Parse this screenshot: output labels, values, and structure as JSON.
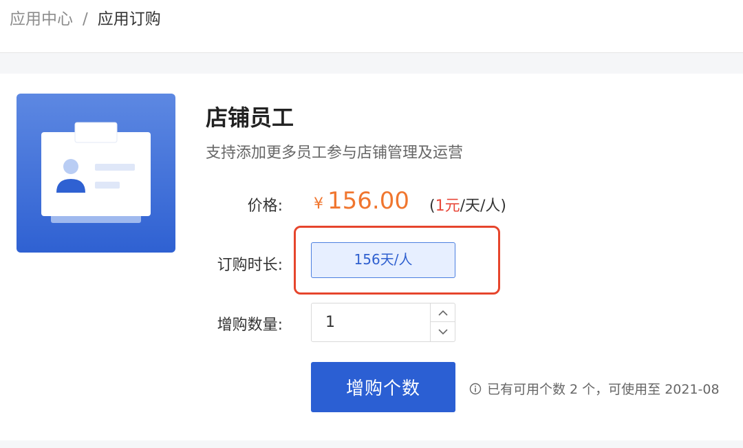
{
  "breadcrumb": {
    "parent": "应用中心",
    "separator": "/",
    "current": "应用订购"
  },
  "product": {
    "title": "店铺员工",
    "description": "支持添加更多员工参与店铺管理及运营",
    "icon": "staff-badge-icon"
  },
  "price": {
    "label": "价格:",
    "currency": "¥",
    "amount": "156.00",
    "unit_open": "(",
    "unit_price": "1元",
    "unit_rest": "/天/人)"
  },
  "duration": {
    "label": "订购时长:",
    "selected_option": "156天/人"
  },
  "quantity": {
    "label": "增购数量:",
    "value": "1"
  },
  "buy_button": {
    "label": "增购个数"
  },
  "note": {
    "text": "已有可用个数 2 个，可使用至 2021-08"
  },
  "colors": {
    "accent": "#2b5fd3",
    "price": "#f0762f",
    "highlight_border": "#e6452c",
    "option_bg": "#e7efff"
  }
}
